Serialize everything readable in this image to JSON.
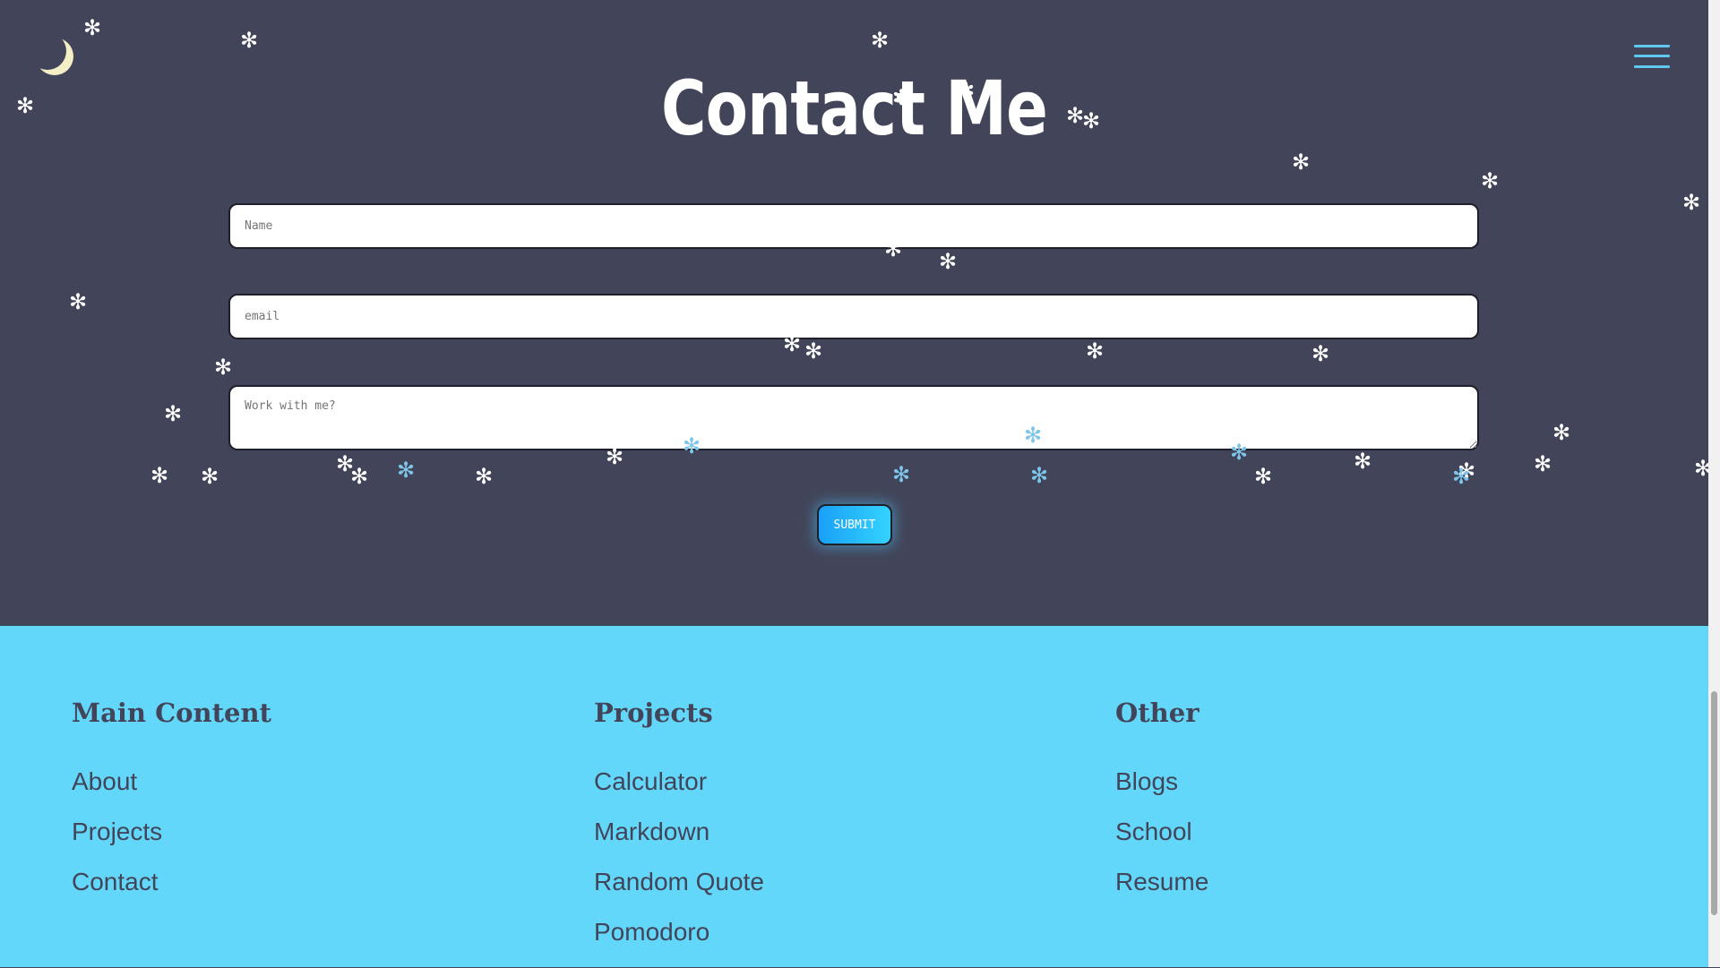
{
  "hero": {
    "title": "Contact Me",
    "theme_icon": "moon-icon",
    "menu_icon": "hamburger-menu-icon"
  },
  "form": {
    "name": {
      "placeholder": "Name",
      "value": ""
    },
    "email": {
      "placeholder": "email",
      "value": ""
    },
    "message": {
      "placeholder": "Work with me?",
      "value": ""
    },
    "submit_label": "SUBMIT"
  },
  "footer": {
    "columns": [
      {
        "heading": "Main Content",
        "links": [
          "About",
          "Projects",
          "Contact"
        ]
      },
      {
        "heading": "Projects",
        "links": [
          "Calculator",
          "Markdown",
          "Random Quote",
          "Pomodoro"
        ]
      },
      {
        "heading": "Other",
        "links": [
          "Blogs",
          "School",
          "Resume"
        ]
      }
    ]
  },
  "colors": {
    "background": "#424559",
    "footer": "#62d7f9",
    "accent": "#1aa0f6",
    "moon": "#f4efc6",
    "snow": "#ffffff",
    "snow_blue": "#7ec5ea"
  }
}
